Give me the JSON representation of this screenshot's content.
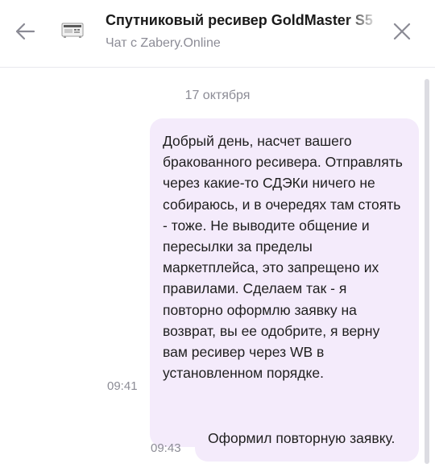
{
  "header": {
    "title": "Спутниковый ресивер GoldMaster S5",
    "subtitle": "Чат с Zabery.Online",
    "back_icon": "back-arrow-icon",
    "close_icon": "close-icon",
    "thumbnail": "receiver-thumbnail"
  },
  "chat": {
    "date_separator": "17 октября",
    "messages": [
      {
        "text": "Добрый день, насчет вашего бракованного ресивера. Отправлять через какие-то СДЭКи ничего не собираюсь, и в очередях там стоять - тоже. Не выводите общение и пересылки за пределы маркетплейса, это запрещено их правилами. Сделаем так - я повторно оформлю заявку на возврат, вы ее одобрите, я верну вам ресивер через WB в установленном порядке.",
        "time": "09:41"
      },
      {
        "text": "Оформил повторную заявку.",
        "time": "09:43"
      }
    ]
  },
  "colors": {
    "bubble": "#f4ebfb",
    "muted_text": "#8c8c96",
    "text": "#1f1f1f"
  }
}
